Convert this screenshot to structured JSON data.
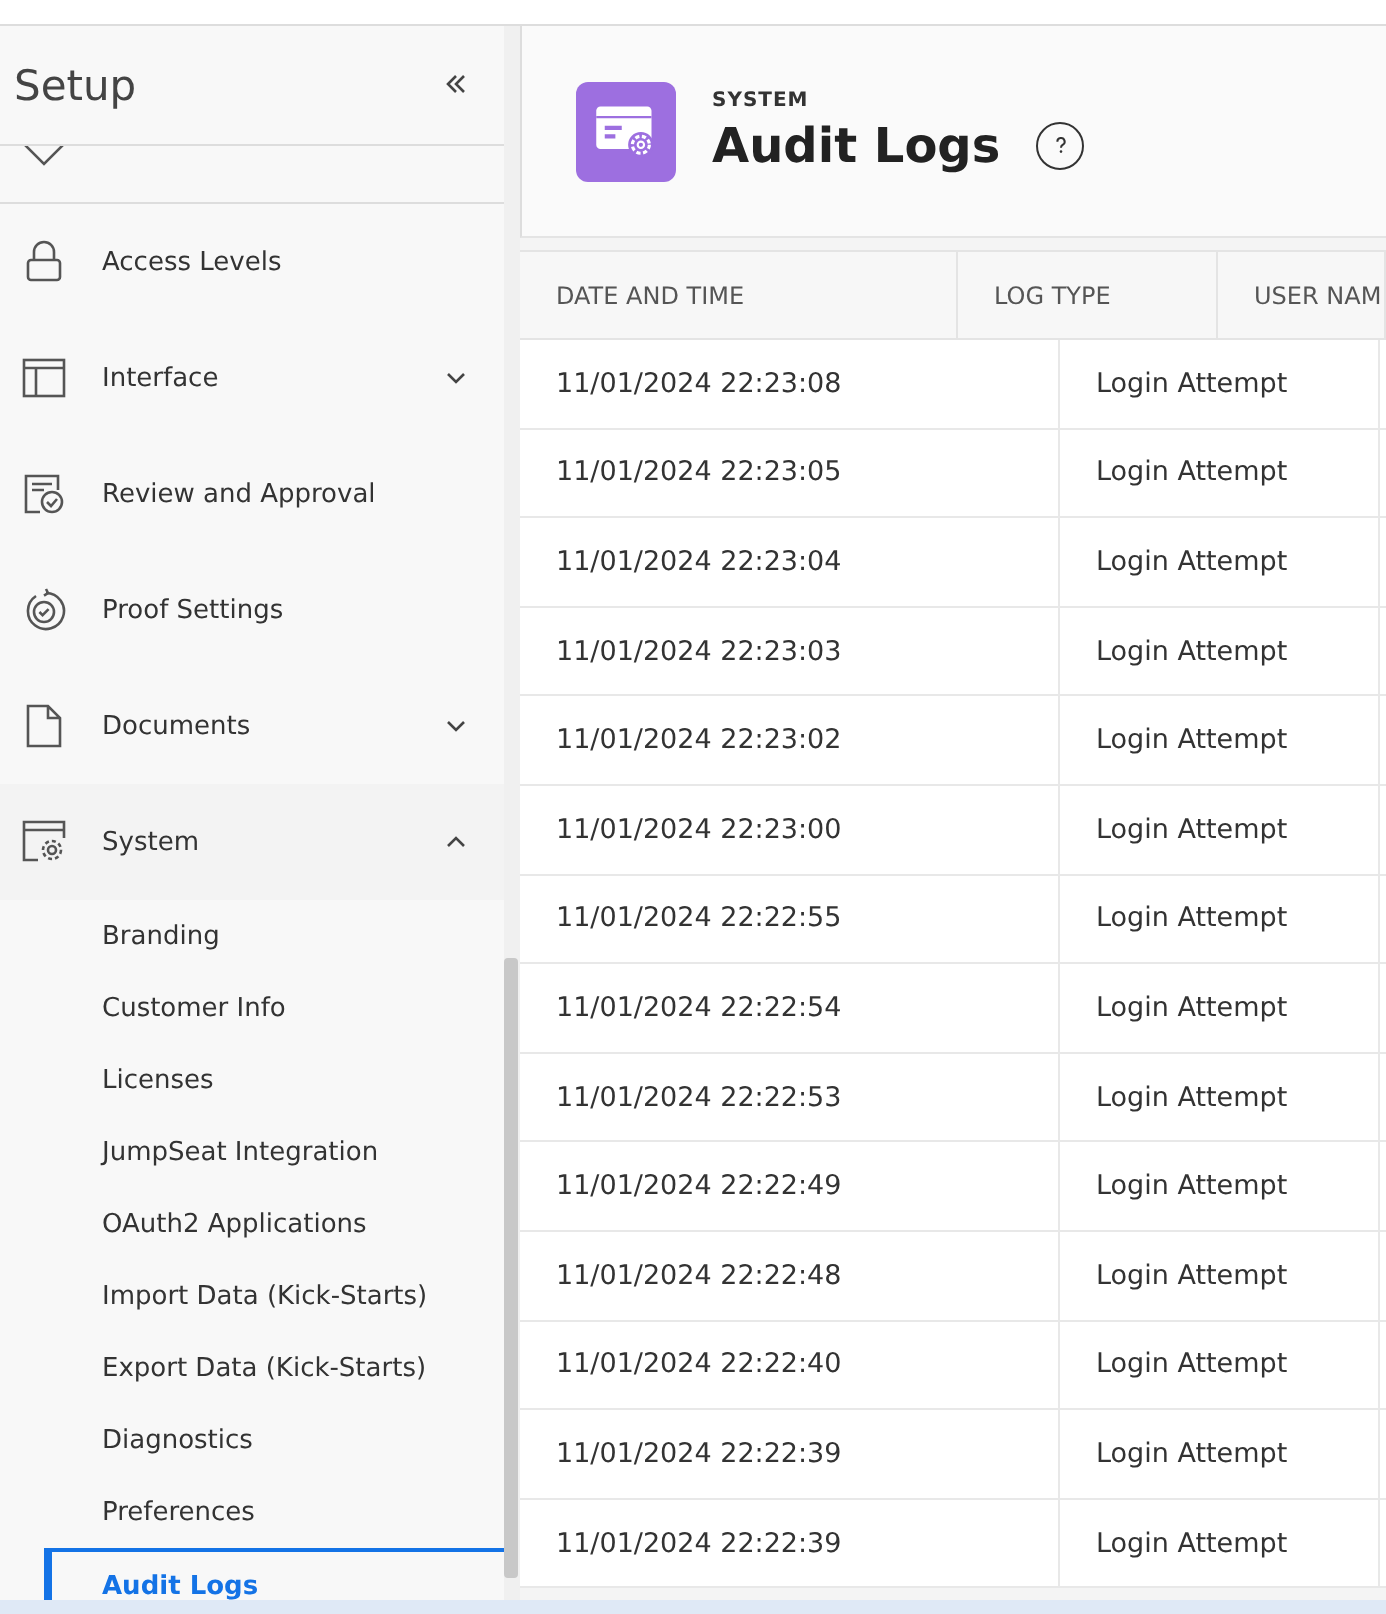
{
  "sidebar": {
    "title": "Setup",
    "items": [
      {
        "label": "Access Levels",
        "kind": "lock"
      },
      {
        "label": "Interface",
        "kind": "layout",
        "expanded": false
      },
      {
        "label": "Review and Approval",
        "kind": "review"
      },
      {
        "label": "Proof Settings",
        "kind": "proof"
      },
      {
        "label": "Documents",
        "kind": "document",
        "expanded": false
      },
      {
        "label": "System",
        "kind": "system",
        "expanded": true,
        "children": [
          {
            "label": "Branding",
            "selected": false
          },
          {
            "label": "Customer Info",
            "selected": false
          },
          {
            "label": "Licenses",
            "selected": false
          },
          {
            "label": "JumpSeat Integration",
            "selected": false
          },
          {
            "label": "OAuth2 Applications",
            "selected": false
          },
          {
            "label": "Import Data (Kick-Starts)",
            "selected": false
          },
          {
            "label": "Export Data (Kick-Starts)",
            "selected": false
          },
          {
            "label": "Diagnostics",
            "selected": false
          },
          {
            "label": "Preferences",
            "selected": false
          },
          {
            "label": "Audit Logs",
            "selected": true
          }
        ]
      }
    ]
  },
  "header": {
    "section": "SYSTEM",
    "title": "Audit Logs"
  },
  "table": {
    "columns": [
      "DATE AND TIME",
      "LOG TYPE",
      "USER NAM"
    ],
    "rows": [
      [
        "11/01/2024 22:23:08",
        "Login Attempt"
      ],
      [
        "11/01/2024 22:23:05",
        "Login Attempt"
      ],
      [
        "11/01/2024 22:23:04",
        "Login Attempt"
      ],
      [
        "11/01/2024 22:23:03",
        "Login Attempt"
      ],
      [
        "11/01/2024 22:23:02",
        "Login Attempt"
      ],
      [
        "11/01/2024 22:23:00",
        "Login Attempt"
      ],
      [
        "11/01/2024 22:22:55",
        "Login Attempt"
      ],
      [
        "11/01/2024 22:22:54",
        "Login Attempt"
      ],
      [
        "11/01/2024 22:22:53",
        "Login Attempt"
      ],
      [
        "11/01/2024 22:22:49",
        "Login Attempt"
      ],
      [
        "11/01/2024 22:22:48",
        "Login Attempt"
      ],
      [
        "11/01/2024 22:22:40",
        "Login Attempt"
      ],
      [
        "11/01/2024 22:22:39",
        "Login Attempt"
      ],
      [
        "11/01/2024 22:22:39",
        "Login Attempt"
      ]
    ]
  }
}
